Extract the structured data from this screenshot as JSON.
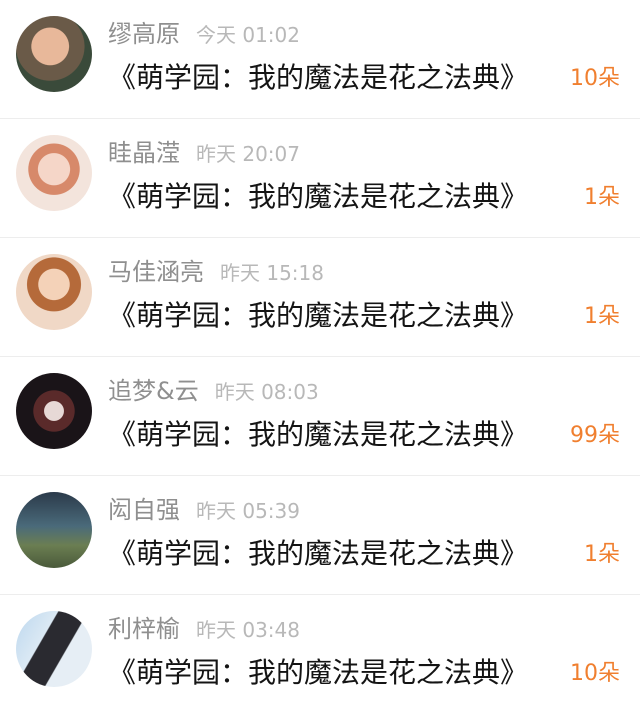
{
  "rows": [
    {
      "name": "缪高原",
      "time": "今天 01:02",
      "title": "《萌学园：我的魔法是花之法典》",
      "count": "10朵"
    },
    {
      "name": "眭晶滢",
      "time": "昨天 20:07",
      "title": "《萌学园：我的魔法是花之法典》",
      "count": "1朵"
    },
    {
      "name": "马佳涵亮",
      "time": "昨天 15:18",
      "title": "《萌学园：我的魔法是花之法典》",
      "count": "1朵"
    },
    {
      "name": "追梦&云",
      "time": "昨天 08:03",
      "title": "《萌学园：我的魔法是花之法典》",
      "count": "99朵"
    },
    {
      "name": "闳自强",
      "time": "昨天 05:39",
      "title": "《萌学园：我的魔法是花之法典》",
      "count": "1朵"
    },
    {
      "name": "利梓榆",
      "time": "昨天 03:48",
      "title": "《萌学园：我的魔法是花之法典》",
      "count": "10朵"
    }
  ]
}
